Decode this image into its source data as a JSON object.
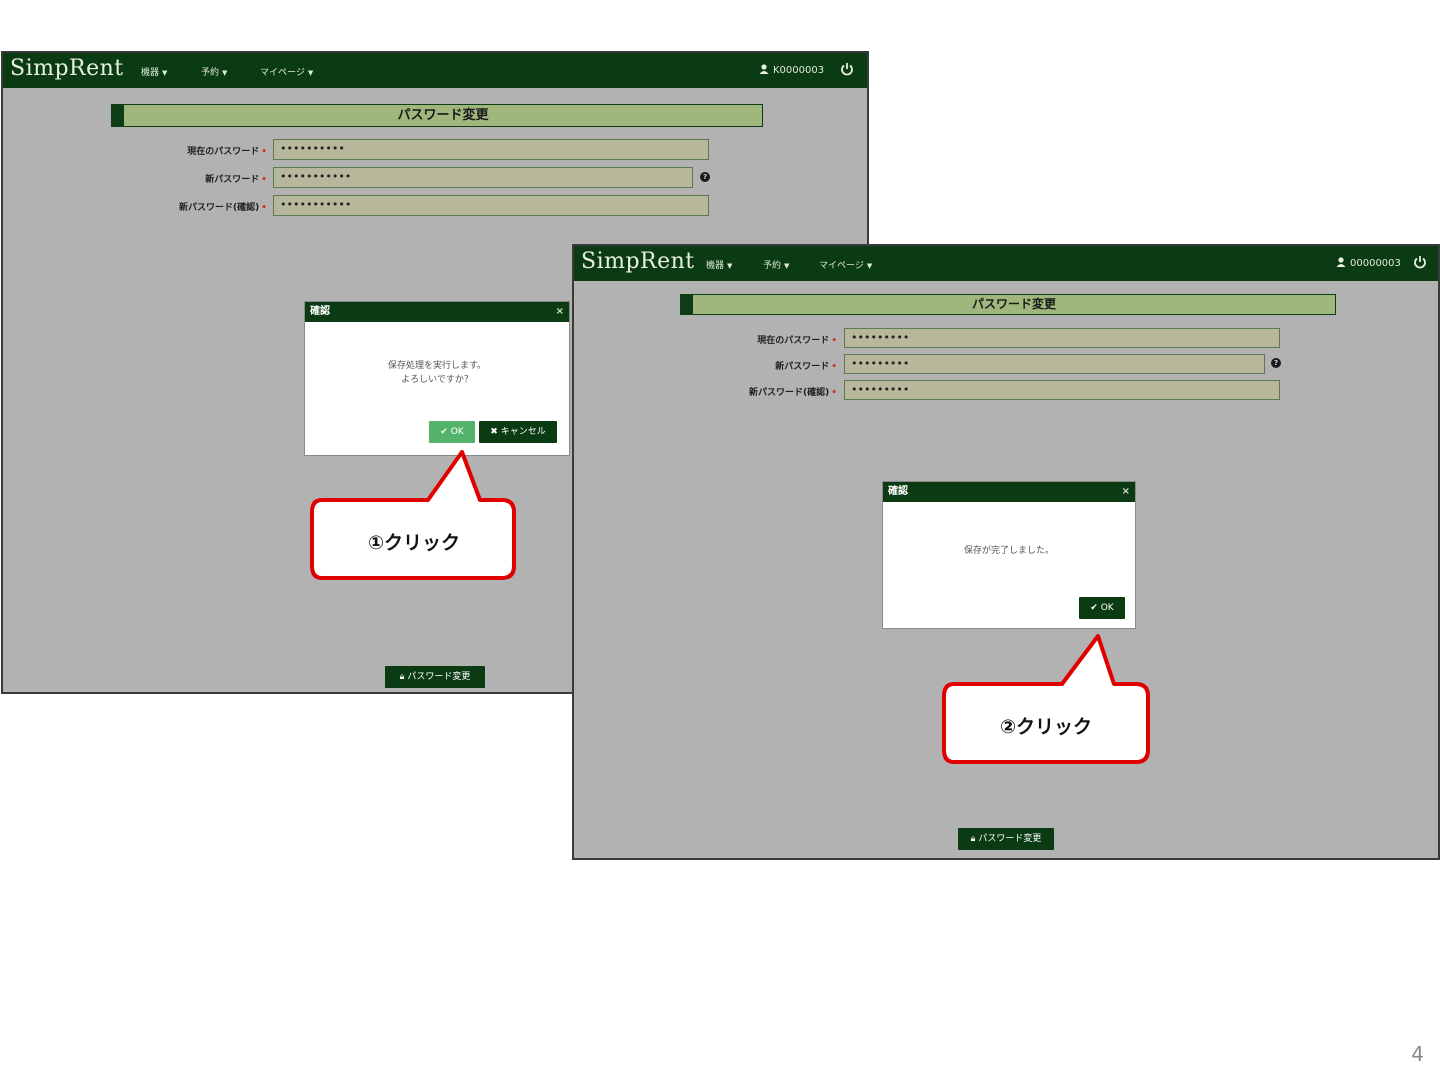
{
  "colors": {
    "nav_bg": "#0b3b12",
    "heading_bg": "#9fb67d",
    "panel_bg": "#b2b2b2",
    "ok_light": "#53b36b",
    "callout_border": "#e00000"
  },
  "screen1": {
    "brand": "SimpRent",
    "menu": [
      "機器",
      "予約",
      "マイページ"
    ],
    "user_id": "K0000003",
    "heading": "パスワード変更",
    "fields": [
      {
        "label": "現在のパスワード",
        "value": "••••••••••"
      },
      {
        "label": "新パスワード",
        "value": "•••••••••••"
      },
      {
        "label": "新パスワード(確認)",
        "value": "•••••••••••"
      }
    ],
    "dialog": {
      "title": "確認",
      "close": "×",
      "line1": "保存処理を実行します。",
      "line2": "よろしいですか？",
      "ok": "OK",
      "cancel": "キャンセル"
    },
    "bottom_button": "パスワード変更"
  },
  "screen2": {
    "brand": "SimpRent",
    "menu": [
      "機器",
      "予約",
      "マイページ"
    ],
    "user_id": "00000003",
    "heading": "パスワード変更",
    "fields": [
      {
        "label": "現在のパスワード",
        "value": "•••••••••"
      },
      {
        "label": "新パスワード",
        "value": "•••••••••"
      },
      {
        "label": "新パスワード(確認)",
        "value": "•••••••••"
      }
    ],
    "dialog": {
      "title": "確認",
      "close": "×",
      "message": "保存が完了しました。",
      "ok": "OK"
    },
    "bottom_button": "パスワード変更"
  },
  "callouts": [
    "①クリック",
    "②クリック"
  ],
  "page_number": "4"
}
